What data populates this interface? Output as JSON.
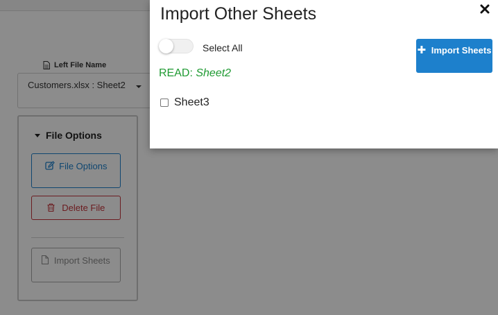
{
  "background": {
    "file_label": "Left File Name",
    "file_select_value": "Customers.xlsx : Sheet2",
    "options_panel": {
      "title": "File Options",
      "file_options_button": "File Options",
      "delete_file_button": "Delete File",
      "import_sheets_button": "Import Sheets"
    }
  },
  "modal": {
    "title": "Import Other Sheets",
    "select_all_label": "Select All",
    "select_all_checked": false,
    "read_prefix": "READ:",
    "read_sheet": "Sheet2",
    "sheets": [
      {
        "name": "Sheet3",
        "checked": false
      }
    ],
    "import_button": "Import Sheets",
    "colors": {
      "primary": "#1d80cc",
      "danger": "#c4343b",
      "read_green": "#1f9a32"
    }
  }
}
